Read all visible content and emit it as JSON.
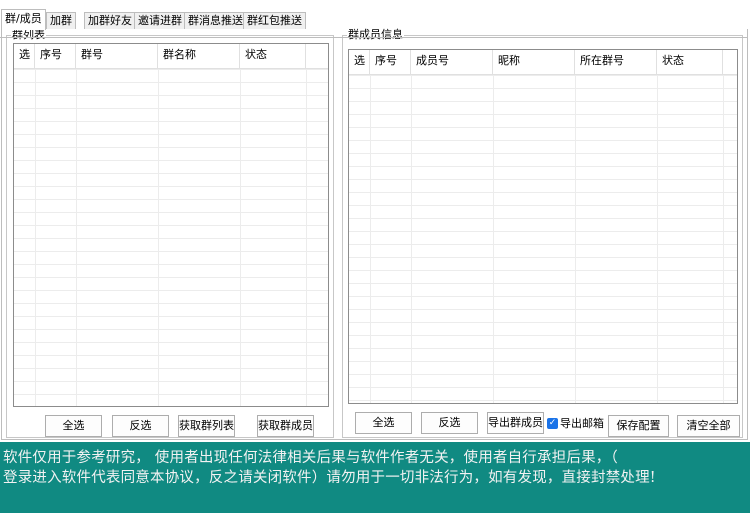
{
  "tabs": [
    {
      "label": "群/成员",
      "active": true
    },
    {
      "label": "加群",
      "active": false
    },
    {
      "label": "加群好友",
      "active": false
    },
    {
      "label": "邀请进群",
      "active": false
    },
    {
      "label": "群消息推送",
      "active": false
    },
    {
      "label": "群红包推送",
      "active": false
    }
  ],
  "group_list": {
    "title": "群列表",
    "columns": [
      "选",
      "序号",
      "群号",
      "群名称",
      "状态"
    ],
    "buttons": [
      "全选",
      "反选",
      "获取群列表",
      "获取群成员"
    ]
  },
  "member_info": {
    "title": "群成员信息",
    "columns": [
      "选",
      "序号",
      "成员号",
      "昵称",
      "所在群号",
      "状态"
    ],
    "buttons": {
      "select_all": "全选",
      "invert": "反选",
      "export_members": "导出群成员",
      "save_config": "保存配置",
      "clear_all": "清空全部"
    },
    "export_email": {
      "label": "导出邮箱",
      "checked": true
    }
  },
  "footer": {
    "line1": "软件仅用于参考研究， 使用者出现任何法律相关后果与软件作者无关，使用者自行承担后果，（",
    "line2": "登录进入软件代表同意本协议，反之请关闭软件）请勿用于一切非法行为，如有发现，直接封禁处理!"
  },
  "colors": {
    "footer_bg": "#108a82",
    "footer_text": "#f2f2f2",
    "checkbox": "#1a73e8"
  }
}
